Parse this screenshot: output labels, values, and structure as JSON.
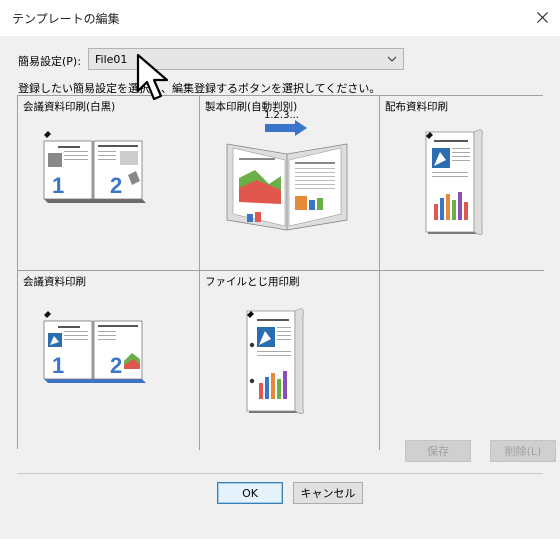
{
  "window": {
    "title": "テンプレートの編集"
  },
  "preset": {
    "label": "簡易設定(P):",
    "value": "File01"
  },
  "instruction": "登録したい簡易設定を選択し、編集登録するボタンを選択してください。",
  "templates": [
    {
      "label": "会議資料印刷(白黒)",
      "icon": "two-up-booklet-bw-icon"
    },
    {
      "label": "製本印刷(自動判別)",
      "sublabel": "1.2.3...",
      "icon": "booklet-auto-icon"
    },
    {
      "label": "配布資料印刷",
      "icon": "handout-icon"
    },
    {
      "label": "会議資料印刷",
      "icon": "two-up-booklet-color-icon"
    },
    {
      "label": "ファイルとじ用印刷",
      "icon": "hole-punch-file-icon"
    },
    {
      "label": "",
      "icon": ""
    }
  ],
  "buttons": {
    "save": "保存",
    "delete": "削除(L)",
    "ok": "OK",
    "cancel": "キャンセル"
  },
  "colors": {
    "accent_blue": "#3b75c9",
    "dialog_bg": "#f0f0f0",
    "cell_border": "#a0a0a0"
  }
}
